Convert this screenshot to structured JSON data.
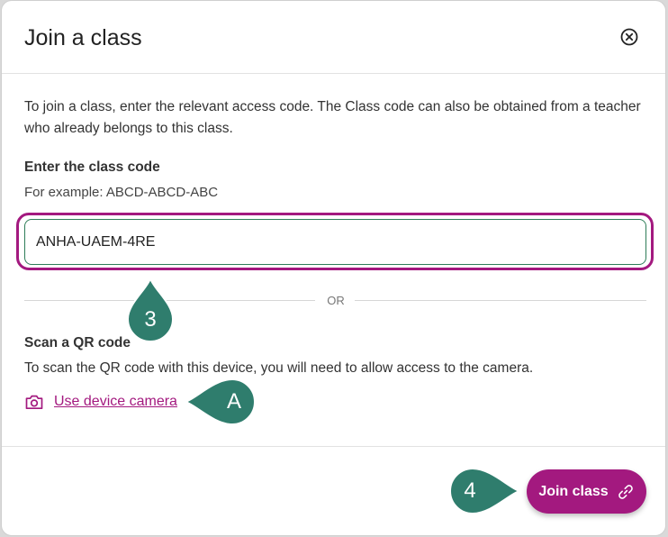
{
  "dialog": {
    "title": "Join a class",
    "close_icon": "close-circle-icon",
    "intro_text": "To join a class, enter the relevant access code. The Class code can also be obtained from a teacher who already belongs to this class.",
    "code_label": "Enter the class code",
    "code_hint": "For example: ABCD-ABCD-ABC",
    "code_value": "ANHA-UAEM-4RE",
    "divider_text": "OR",
    "qr_label": "Scan a QR code",
    "qr_description": "To scan the QR code with this device, you will need to allow access to the camera.",
    "camera_link_icon": "camera-icon",
    "camera_link_label": "Use device camera",
    "join_button_label": "Join class",
    "join_button_icon": "link-icon"
  },
  "annotations": {
    "step_3": "3",
    "step_a": "A",
    "step_4": "4"
  },
  "colors": {
    "accent": "#a3197f",
    "input_border": "#2e7d58",
    "marker": "#2f7d6d"
  }
}
